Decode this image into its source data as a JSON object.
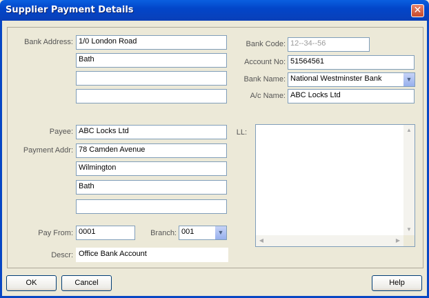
{
  "window": {
    "title": "Supplier Payment Details"
  },
  "bank": {
    "address_label": "Bank Address:",
    "address_lines": [
      "1/0 London Road",
      "Bath",
      "",
      ""
    ],
    "code_label": "Bank Code:",
    "code_value": "12--34--56",
    "account_no_label": "Account No:",
    "account_no_value": "51564561",
    "bank_name_label": "Bank Name:",
    "bank_name_value": "National Westminster Bank",
    "ac_name_label": "A/c Name:",
    "ac_name_value": "ABC Locks Ltd"
  },
  "payee": {
    "payee_label": "Payee:",
    "payee_value": "ABC Locks Ltd",
    "payment_addr_label": "Payment Addr:",
    "address_lines": [
      "78 Camden Avenue",
      "Wilmington",
      "Bath",
      ""
    ],
    "pay_from_label": "Pay From:",
    "pay_from_value": "0001",
    "branch_label": "Branch:",
    "branch_value": "001",
    "descr_label": "Descr:",
    "descr_value": "Office Bank Account",
    "ll_label": "LL:",
    "ll_value": ""
  },
  "buttons": {
    "ok": "OK",
    "cancel": "Cancel",
    "help": "Help"
  },
  "icons": {
    "close": "close-icon",
    "dropdown": "chevron-down-icon"
  },
  "colors": {
    "title_bar": "#0A5FE0",
    "window_bg": "#ECE9D8",
    "field_border": "#7F9DB9"
  }
}
